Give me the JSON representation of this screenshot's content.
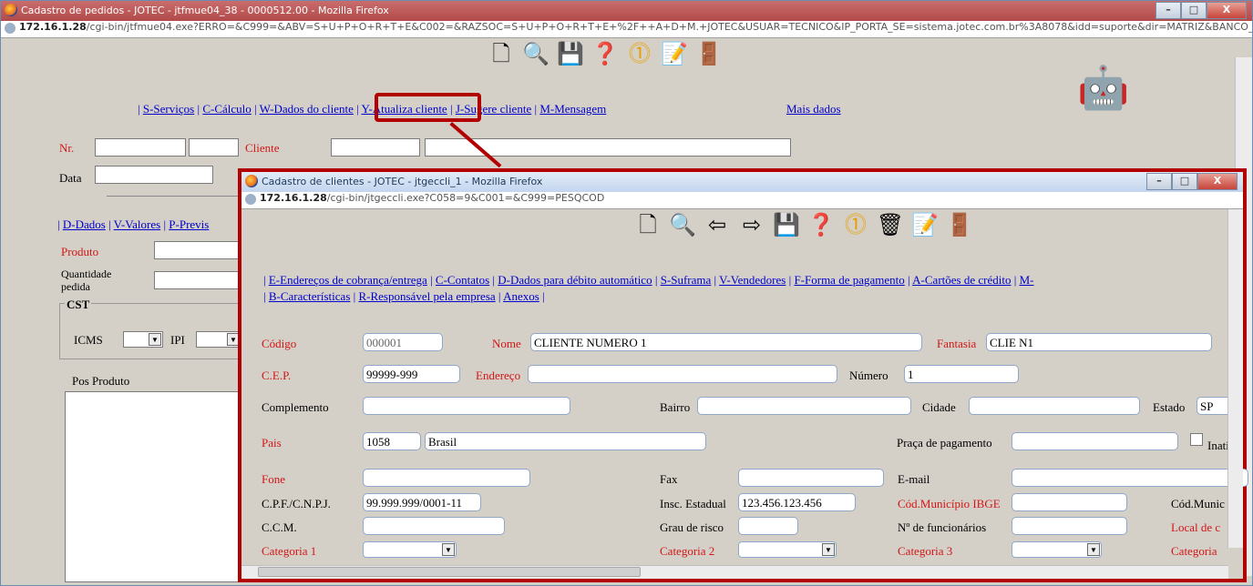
{
  "main_window": {
    "title": "Cadastro de pedidos - JOTEC - jtfmue04_38 - 0000512.00 - Mozilla Firefox",
    "url_host": "172.16.1.28",
    "url_path": "/cgi-bin/jtfmue04.exe?ERRO=&C999=&ABV=S+U+P+O+R+T+E&C002=&RAZSOC=S+U+P+O+R+T+E+%2F++A+D+M.+JOTEC&USUAR=TECNICO&IP_PORTA_SE=sistema.jotec.com.br%3A8078&idd=suporte&dir=MATRIZ&BANCO_",
    "toolbar_icons": [
      "new-document-icon",
      "binoculars-icon",
      "save-icon",
      "help-icon",
      "warning-icon",
      "notepad-icon",
      "exit-icon"
    ],
    "menu": [
      {
        "label": "S-Serviços"
      },
      {
        "label": "C-Cálculo"
      },
      {
        "label": "W-Dados do cliente"
      },
      {
        "label": "Y-Atualiza cliente"
      },
      {
        "label": "J-Sugere cliente"
      },
      {
        "label": "M-Mensagem"
      }
    ],
    "mais_dados": "Mais dados",
    "labels": {
      "nr": "Nr.",
      "cliente": "Cliente",
      "data": "Data",
      "produto": "Produto",
      "quantidade": "Quantidade pedida",
      "cst": "CST",
      "icms": "ICMS",
      "ipi": "IPI",
      "pos_produto": "Pos  Produto"
    },
    "tabs": [
      {
        "label": "D-Dados"
      },
      {
        "label": "V-Valores"
      },
      {
        "label": "P-Previs"
      }
    ]
  },
  "client_window": {
    "title": "Cadastro de clientes - JOTEC - jtgeccli_1 - Mozilla Firefox",
    "url_host": "172.16.1.28",
    "url_path": "/cgi-bin/jtgeccli.exe?C058=9&C001=&C999=PESQCOD",
    "toolbar_icons": [
      "new-document-icon",
      "binoculars-icon",
      "back-arrow-icon",
      "forward-arrow-icon",
      "save-icon",
      "help-icon",
      "warning-icon",
      "trash-icon",
      "notepad-icon",
      "exit-icon"
    ],
    "menu_row1": [
      {
        "label": "E-Endereços de cobrança/entrega"
      },
      {
        "label": "C-Contatos"
      },
      {
        "label": "D-Dados para débito automático"
      },
      {
        "label": "S-Suframa"
      },
      {
        "label": "V-Vendedores"
      },
      {
        "label": "F-Forma de pagamento"
      },
      {
        "label": "A-Cartões de crédito"
      },
      {
        "label": "M-"
      }
    ],
    "menu_row2": [
      {
        "label": "B-Características"
      },
      {
        "label": "R-Responsável pela empresa"
      },
      {
        "label": "Anexos"
      }
    ],
    "fields": {
      "codigo_label": "Código",
      "codigo_value": "000001",
      "nome_label": "Nome",
      "nome_value": "CLIENTE NUMERO 1",
      "fantasia_label": "Fantasia",
      "fantasia_value": "CLIE N1",
      "cep_label": "C.E.P.",
      "cep_value": "99999-999",
      "endereco_label": "Endereço",
      "endereco_value": "",
      "numero_label": "Número",
      "numero_value": "1",
      "complemento_label": "Complemento",
      "bairro_label": "Bairro",
      "cidade_label": "Cidade",
      "estado_label": "Estado",
      "estado_value": "SP",
      "pais_label": "Pais",
      "pais_code": "1058",
      "pais_name": "Brasil",
      "praca_label": "Praça de pagamento",
      "inativo_label": "Inativo",
      "fone_label": "Fone",
      "fax_label": "Fax",
      "email_label": "E-mail",
      "cpf_label": "C.P.F./C.N.P.J.",
      "cpf_value": "99.999.999/0001-11",
      "insc_label": "Insc. Estadual",
      "insc_value": "123.456.123.456",
      "cod_ibge_label": "Cód.Município IBGE",
      "cod_munic_label": "Cód.Munic",
      "ccm_label": "C.C.M.",
      "grau_label": "Grau de risco",
      "funcionarios_label": "Nº de funcionários",
      "local_label": "Local de c",
      "cat1_label": "Categoria 1",
      "cat2_label": "Categoria 2",
      "cat3_label": "Categoria 3",
      "cat4_label": "Categoria"
    }
  },
  "colors": {
    "highlight": "#b20000",
    "link": "#0000cc",
    "required_label": "#d41616"
  }
}
